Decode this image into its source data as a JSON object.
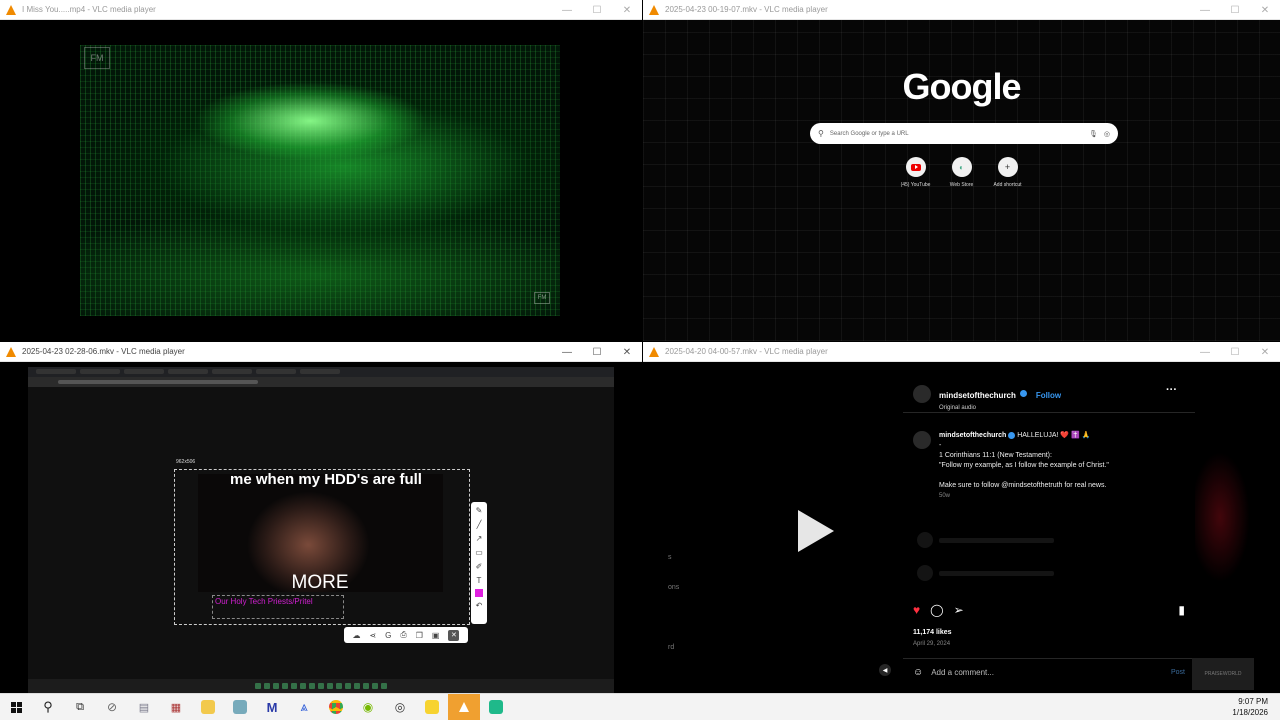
{
  "windows": {
    "top_left": {
      "title": "I Miss You.....mp4 - VLC media player",
      "video_logo": "FM",
      "corner_logo": "FM"
    },
    "top_right": {
      "title": "2025-04-23 00-19-07.mkv - VLC media player",
      "google_logo": "Google",
      "search_placeholder": "Search Google or type a URL",
      "shortcuts": [
        {
          "label": "(45) YouTube",
          "icon": "youtube-icon"
        },
        {
          "label": "Web Store",
          "icon": "web-store-icon"
        },
        {
          "label": "Add shortcut",
          "icon": "plus-icon"
        }
      ]
    },
    "bottom_left": {
      "title": "2025-04-23 02-28-06.mkv - VLC media player",
      "selection_size": "962x506",
      "meme_top": "me when my HDD's are full",
      "meme_bottom": "MORE",
      "caption": "Our Holy Tech Priests/Pritel"
    },
    "bottom_right": {
      "title": "2025-04-20 04-00-57.mkv - VLC media player",
      "username": "mindsetofthechurch",
      "follow": "Follow",
      "audio": "Original audio",
      "caption_user": "mindsetofthechurch",
      "caption_lead": "HALLELUJA! ❤️ ✝️ 🙏",
      "caption_dash": "-",
      "caption_verse_ref": "1 Corinthians 11:1 (New Testament):",
      "caption_verse": "\"Follow my example, as I follow the example of Christ.\"",
      "caption_follow": "Make sure to follow @mindsetofthetruth for real news.",
      "caption_time": "50w",
      "likes": "11,174 likes",
      "date": "April 29, 2024",
      "comment_placeholder": "Add a comment...",
      "post": "Post",
      "side_texts": [
        "s",
        "ons",
        "rd"
      ],
      "watermark": "PRAISEWORLD"
    }
  },
  "taskbar": {
    "time": "9:07 PM",
    "date": "1/18/2026"
  },
  "colors": {
    "vlc_orange": "#f08a00",
    "instagram_blue": "#3897f0",
    "like_red": "#ff3040"
  }
}
